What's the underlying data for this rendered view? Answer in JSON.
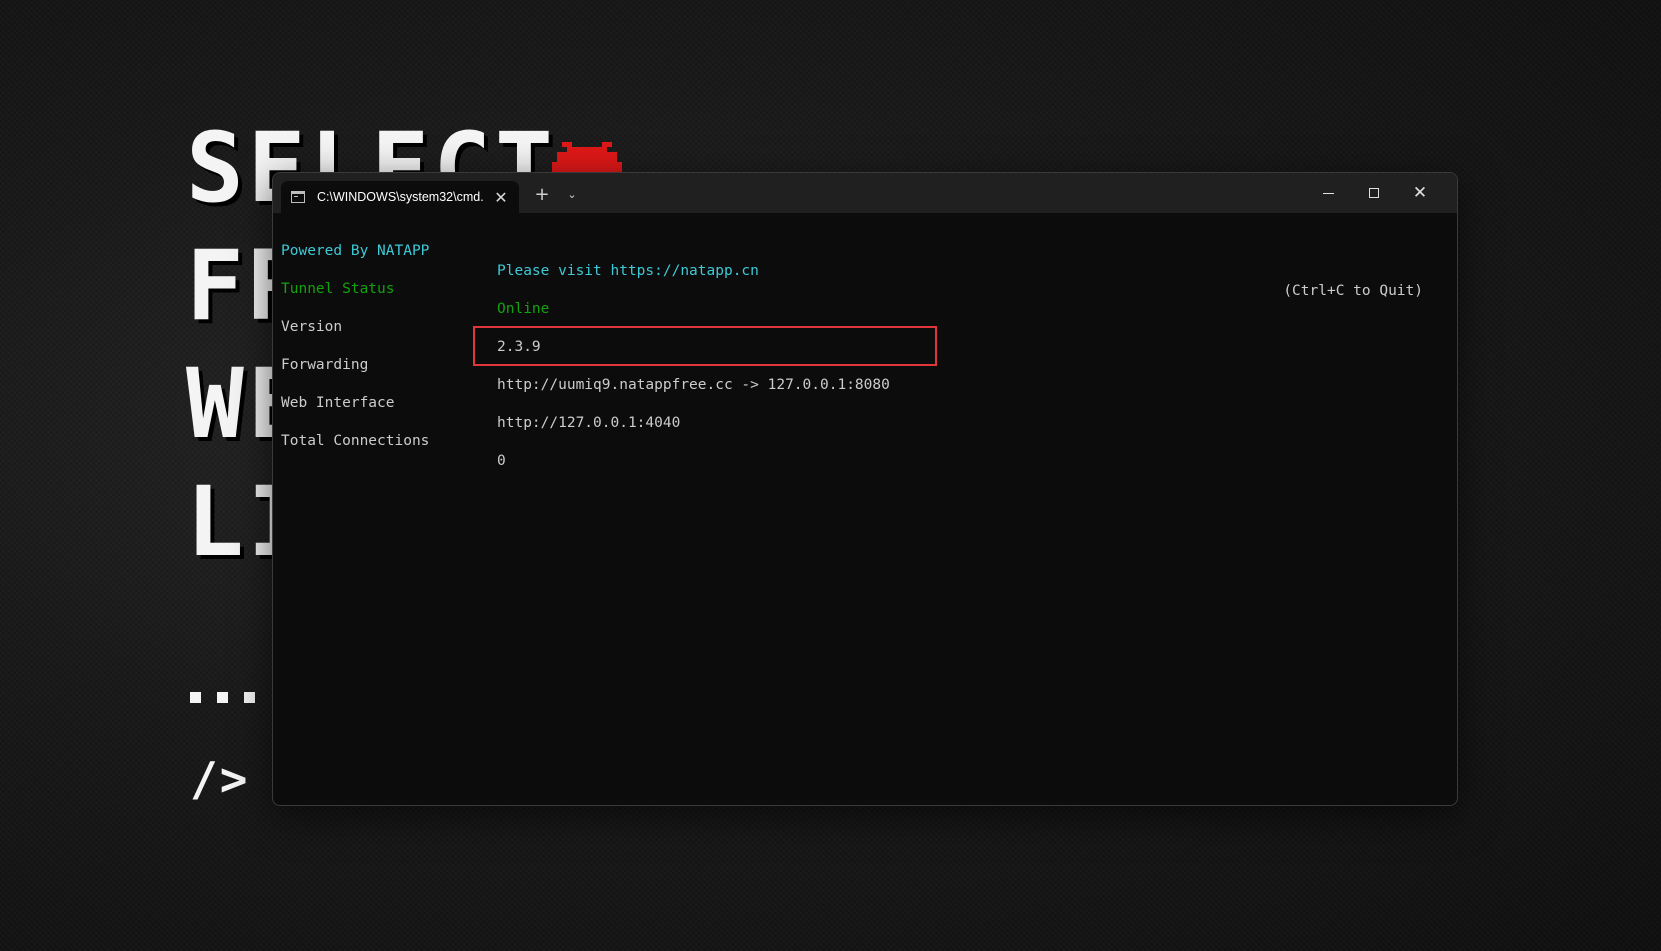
{
  "wallpaper": {
    "line1": "SELECT",
    "line2": "FR",
    "line3": "WE",
    "line4": "LI",
    "prompt": "/>"
  },
  "window": {
    "tab_title": "C:\\WINDOWS\\system32\\cmd.",
    "tab_icon": "terminal-icon",
    "new_tab": "+",
    "dropdown": "⌄",
    "close_glyph": "✕"
  },
  "terminal": {
    "powered_by": "Powered By NATAPP",
    "visit": "Please visit https://natapp.cn",
    "quit_hint": "(Ctrl+C to Quit)",
    "rows": [
      {
        "label": "Tunnel Status",
        "value": "Online"
      },
      {
        "label": "Version",
        "value": "2.3.9"
      },
      {
        "label": "Forwarding",
        "value": "http://uumiq9.natappfree.cc -> 127.0.0.1:8080"
      },
      {
        "label": "Web Interface",
        "value": "http://127.0.0.1:4040"
      },
      {
        "label": "Total Connections",
        "value": "0"
      }
    ]
  },
  "colors": {
    "cyan": "#3ec9d6",
    "green": "#13a10e",
    "highlight": "#e0353a",
    "invader": "#e01818"
  }
}
